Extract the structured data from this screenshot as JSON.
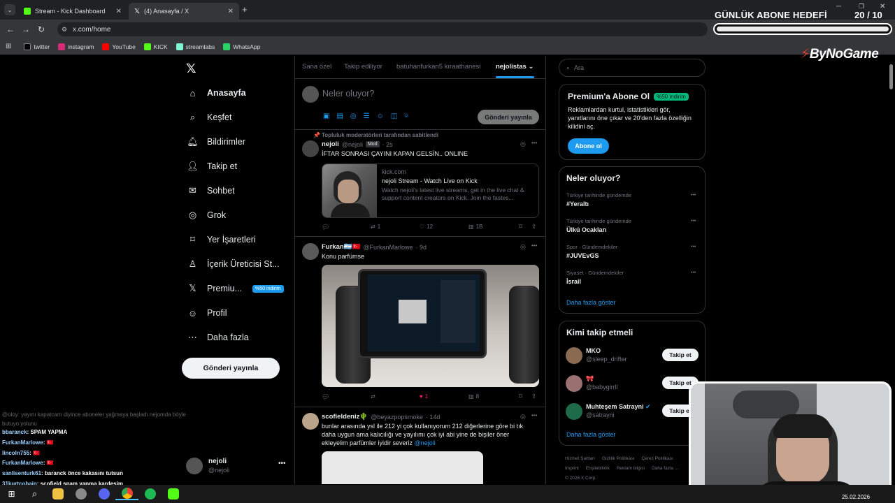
{
  "browser": {
    "tabs": [
      {
        "title": "Stream - Kick Dashboard",
        "active": false
      },
      {
        "title": "(4) Anasayfa / X",
        "active": true
      }
    ],
    "url": "x.com/home",
    "bookmarks": [
      {
        "label": "twitter",
        "color": "#000000"
      },
      {
        "label": "instagram",
        "color": "#d62976"
      },
      {
        "label": "YouTube",
        "color": "#ff0000"
      },
      {
        "label": "KICK",
        "color": "#53fc18"
      },
      {
        "label": "streamlabs",
        "color": "#80f5d2"
      },
      {
        "label": "WhatsApp",
        "color": "#25d366"
      }
    ]
  },
  "overlay": {
    "goal_title": "GÜNLÜK ABONE HEDEFİ",
    "goal_count": "20  / 10",
    "goal_progress": 1.0,
    "logo": "ByNoGame"
  },
  "sidebar": {
    "items": [
      {
        "label": "Anasayfa",
        "icon": "home-icon",
        "bold": true
      },
      {
        "label": "Keşfet",
        "icon": "search-icon"
      },
      {
        "label": "Bildirimler",
        "icon": "bell-icon"
      },
      {
        "label": "Takip et",
        "icon": "add-user-icon"
      },
      {
        "label": "Sohbet",
        "icon": "mail-icon"
      },
      {
        "label": "Grok",
        "icon": "grok-icon"
      },
      {
        "label": "Yer İşaretleri",
        "icon": "bookmark-icon"
      },
      {
        "label": "İçerik Üreticisi St...",
        "icon": "creator-studio-icon"
      },
      {
        "label": "Premiu...",
        "icon": "x-premium-icon",
        "badge": "%50 indirim"
      },
      {
        "label": "Profil",
        "icon": "profile-icon"
      },
      {
        "label": "Daha fazla",
        "icon": "more-circle-icon"
      }
    ],
    "post_button": "Gönderi yayınla",
    "account": {
      "name": "nejoli",
      "handle": "@nejoli"
    }
  },
  "feed": {
    "tabs": [
      "Sana özel",
      "Takip ediliyor",
      "batuhanfurkan5 kıraathanesi",
      "nejolistas"
    ],
    "compose_placeholder": "Neler oluyor?",
    "compose_button": "Gönderi yayınla",
    "posts": [
      {
        "pinned_label": "Topluluk moderatörleri tarafından sabitlendi",
        "name": "nejoli",
        "handle": "@nejoli",
        "mod": "Mod",
        "time": "· 2s",
        "text": "İFTAR SONRASI ÇAYINI KAPAN GELSİN.. ONLINE",
        "card": {
          "domain": "kick.com",
          "title": "nejoli Stream - Watch Live on Kick",
          "desc": "Watch nejoli's latest live streams, get in the live chat & support content creators on Kick. Join the fastes..."
        },
        "stats": {
          "replies": "",
          "reposts": "1",
          "likes": "12",
          "views": "1B"
        }
      },
      {
        "name": "Furkan🇦🇷🇹🇷",
        "handle": "@FurkanMarlowe",
        "time": "· 9d",
        "text": "Konu parfümse",
        "stats": {
          "replies": "",
          "reposts": "",
          "likes": "1",
          "views": "8"
        }
      },
      {
        "name": "scofieldeniz🌵",
        "handle": "@beyazpopsmoke",
        "time": "· 14d",
        "text_lines": [
          "bunlar arasında ysl ile 212 yi çok kullanıyorum 212 diğerlerine göre bi tık",
          "daha uygun ama kalıcılığı ve yayılımı çok iyi abi yine de bişiler öner",
          "ekleyelim parfümler iyidir severiz "
        ],
        "mention": "@nejoli"
      }
    ]
  },
  "right": {
    "search_placeholder": "Ara",
    "premium": {
      "title": "Premium'a Abone Ol",
      "badge": "%50 indirim",
      "text": "Reklamlardan kurtul, istatistikleri gör, yanıtlarını öne çıkar ve 20'den fazla özelliğin kilidini aç.",
      "button": "Abone ol"
    },
    "trends_title": "Neler oluyor?",
    "trends": [
      {
        "context": "Türkiye tarihinde gündemde",
        "name": "#Yeraltı"
      },
      {
        "context": "Türkiye tarihinde gündemde",
        "name": "Ülkü Ocakları"
      },
      {
        "context": "Spor · Gündemdekiler",
        "name": "#JUVEvGS"
      },
      {
        "context": "Siyaset · Gündemdekiler",
        "name": "İsrail"
      }
    ],
    "show_more": "Daha fazla göster",
    "who_title": "Kimi takip etmeli",
    "who": [
      {
        "name": "MKO",
        "handle": "@sleep_drifter"
      },
      {
        "name": "🎀",
        "handle": "@babygirrll"
      },
      {
        "name": "Muhteşem Satrayni",
        "handle": "@satrayni",
        "verified": true
      }
    ],
    "follow_label": "Takip et",
    "who_more": "Daha fazla göster",
    "footer": [
      "Hizmet Şartları",
      "Gizlilik Politikası",
      "Çerez Politikası",
      "Imprint",
      "Erişilebilirlik",
      "Reklam bilgisi",
      "Daha fazla ...",
      "© 2026 X Corp."
    ]
  },
  "chat": [
    {
      "user": "@oloy",
      "text": ": yayını kapatcam diyince aboneler yağmaya başladı nejomda böyle butuyo yolunu",
      "faded": true
    },
    {
      "user": "bbaranck",
      "text": ": SPAM YAPMA"
    },
    {
      "user": "FurkanMarlowe",
      "text": ": 🇹🇷"
    },
    {
      "user": "lincoln755",
      "text": ": 🇹🇷"
    },
    {
      "user": "FurkanMarlowe",
      "text": ": 🇹🇷"
    },
    {
      "user": "sanlisenturk61",
      "text": ": baranck önce kakasını tutsun"
    },
    {
      "user": "31kurtcobain",
      "text": ": scofield spam yapma kardeşim"
    }
  ],
  "taskbar": {
    "date": "25.02.2026"
  }
}
